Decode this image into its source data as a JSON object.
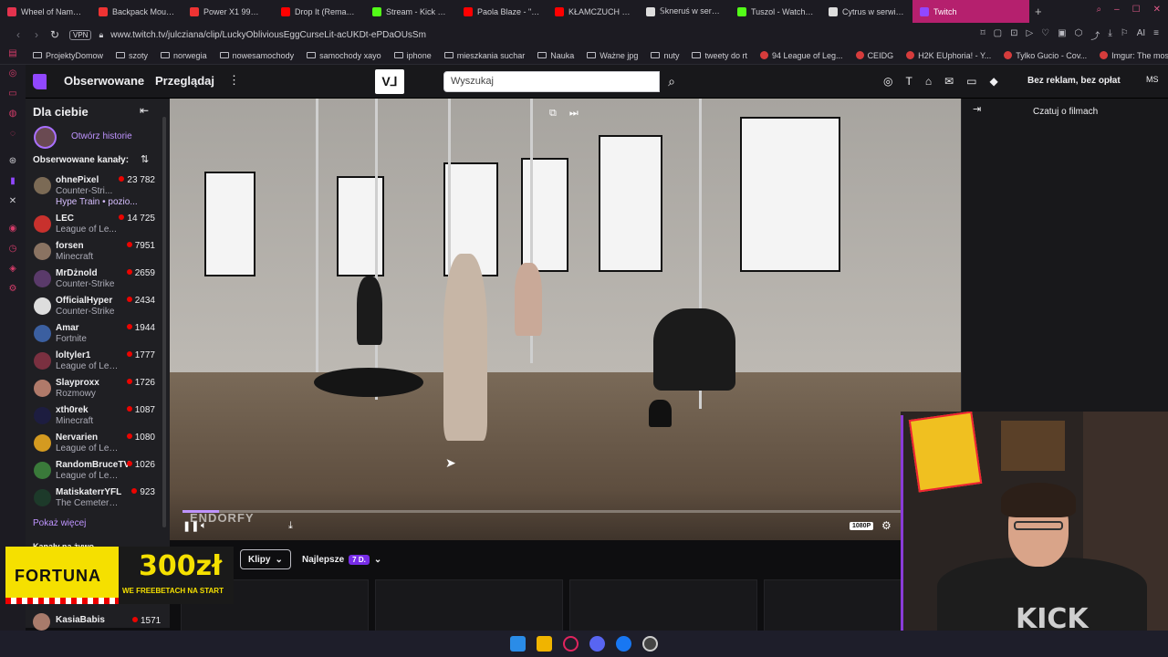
{
  "browser": {
    "tabs": [
      {
        "label": "Wheel of Names |",
        "color": "#e3334e"
      },
      {
        "label": "Backpack Mount f",
        "color": "#e33"
      },
      {
        "label": "Power X1 99Wh Be",
        "color": "#e33"
      },
      {
        "label": "Drop It (Remaster",
        "color": "#f00"
      },
      {
        "label": "Stream - Kick Dash",
        "color": "#53fc18"
      },
      {
        "label": "Paola Blaze - \"rod",
        "color": "#f00"
      },
      {
        "label": "KŁAMCZUCH INF",
        "color": "#f00"
      },
      {
        "label": "𝕊kneruś w serwis",
        "color": "#ddd"
      },
      {
        "label": "Tuszol - Watch cli",
        "color": "#53fc18"
      },
      {
        "label": "Cytrus w serwisie",
        "color": "#ddd"
      },
      {
        "label": "Twitch",
        "color": "#9147ff"
      }
    ],
    "new_tab": "+",
    "vpn_label": "VPN",
    "url": "www.twitch.tv/julcziana/clip/LuckyObliviousEggCurseLit-acUKDt-ePDaOUsSm",
    "bookmarks": [
      {
        "label": "ProjektyDomow",
        "icon": "folder"
      },
      {
        "label": "szoty",
        "icon": "folder"
      },
      {
        "label": "norwegia",
        "icon": "folder"
      },
      {
        "label": "nowesamochody",
        "icon": "folder"
      },
      {
        "label": "samochody xayo",
        "icon": "folder"
      },
      {
        "label": "iphone",
        "icon": "folder"
      },
      {
        "label": "mieszkania suchar",
        "icon": "folder"
      },
      {
        "label": "Nauka",
        "icon": "folder"
      },
      {
        "label": "Ważne jpg",
        "icon": "folder"
      },
      {
        "label": "nuty",
        "icon": "folder"
      },
      {
        "label": "tweety do rt",
        "icon": "folder"
      },
      {
        "label": "94 League of Leg...",
        "icon": "site"
      },
      {
        "label": "CEIDG",
        "icon": "site"
      },
      {
        "label": "H2K EUphoria! - Y...",
        "icon": "site"
      },
      {
        "label": "Tylko Gucio - Cov...",
        "icon": "site"
      },
      {
        "label": "Imgur: The most a...",
        "icon": "site"
      }
    ]
  },
  "twitch_nav": {
    "following": "Obserwowane",
    "browse": "Przeglądaj",
    "more": "⋮",
    "search_placeholder": "Wyszukaj",
    "no_ads": "Bez reklam, bez opłat",
    "user_initials": "MS"
  },
  "sidebar": {
    "title": "Dla ciebie",
    "open_stories": "Otwórz historie",
    "followed_header": "Obserwowane kanały:",
    "channels": [
      {
        "name": "ohnePixel",
        "game": "Counter-Stri...",
        "viewers": "23 782",
        "extra": "Hype Train • pozio...",
        "color": "#7b6a55"
      },
      {
        "name": "LEC",
        "game": "League of Le...",
        "viewers": "14 725",
        "color": "#c8312d"
      },
      {
        "name": "forsen",
        "game": "Minecraft",
        "viewers": "7951",
        "color": "#8a7362"
      },
      {
        "name": "MrDżnold",
        "game": "Counter-Strike",
        "viewers": "2659",
        "color": "#5a3a6a"
      },
      {
        "name": "OfficialHyper",
        "game": "Counter-Strike",
        "viewers": "2434",
        "color": "#dddddd"
      },
      {
        "name": "Amar",
        "game": "Fortnite",
        "viewers": "1944",
        "color": "#3b5fa0"
      },
      {
        "name": "loltyler1",
        "game": "League of Leg...",
        "viewers": "1777",
        "color": "#7a3040"
      },
      {
        "name": "Slayproxx",
        "game": "Rozmowy",
        "viewers": "1726",
        "color": "#b07a6a"
      },
      {
        "name": "xth0rek",
        "game": "Minecraft",
        "viewers": "1087",
        "color": "#1d1d40"
      },
      {
        "name": "Nervarien",
        "game": "League of Leg...",
        "viewers": "1080",
        "color": "#d49a20"
      },
      {
        "name": "RandomBruceTV",
        "game": "League of Leg...",
        "viewers": "1026",
        "color": "#3a7a3a"
      },
      {
        "name": "MatiskaterrYFL",
        "game": "The Cemetery ...",
        "viewers": "923",
        "color": "#1d3a2a"
      }
    ],
    "show_more": "Pokaż więcej",
    "live_header": "Kanały na żywo",
    "bottom_channel": {
      "name": "KasiaBabis",
      "viewers": "1571"
    }
  },
  "player": {
    "progress": 0.05,
    "quality": "1080P",
    "watermark": "ENDORFY"
  },
  "chat": {
    "title": "Czatuj o filmach"
  },
  "below": {
    "clips_dropdown": "Klipy",
    "sort_dropdown": "Najlepsze",
    "period_badge": "7 D."
  },
  "ad": {
    "brand": "FORTUNA",
    "amount": "300zł",
    "sub": "WE FREEBETACH NA START"
  },
  "webcam": {
    "shirt_text": "KICK"
  }
}
